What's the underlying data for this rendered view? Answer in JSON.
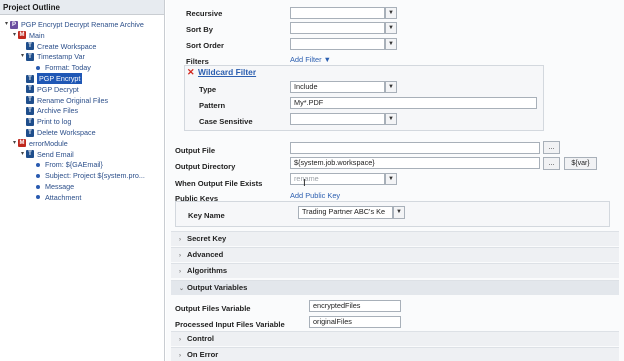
{
  "outline": {
    "title": "Project Outline",
    "nodes": [
      {
        "label": "PGP Encrypt Decrypt Rename Archive",
        "icon": "P",
        "twisty": "▾"
      },
      {
        "label": "Main",
        "icon": "M",
        "twisty": "▾"
      },
      {
        "label": "Create Workspace",
        "icon": "T",
        "twisty": ""
      },
      {
        "label": "Timestamp Var",
        "icon": "T",
        "twisty": "▾"
      },
      {
        "label": "Format: Today",
        "icon": "dot",
        "twisty": ""
      },
      {
        "label": "PGP Encrypt",
        "icon": "T",
        "twisty": ""
      },
      {
        "label": "PGP Decrypt",
        "icon": "T",
        "twisty": ""
      },
      {
        "label": "Rename Original Files",
        "icon": "T",
        "twisty": ""
      },
      {
        "label": "Archive Files",
        "icon": "T",
        "twisty": ""
      },
      {
        "label": "Print to log",
        "icon": "T",
        "twisty": ""
      },
      {
        "label": "Delete Workspace",
        "icon": "T",
        "twisty": ""
      },
      {
        "label": "errorModule",
        "icon": "M",
        "twisty": "▾"
      },
      {
        "label": "Send Email",
        "icon": "T",
        "twisty": "▾"
      },
      {
        "label": "From: ${GAEmail}",
        "icon": "dot",
        "twisty": ""
      },
      {
        "label": "Subject: Project ${system.pro...",
        "icon": "dot",
        "twisty": ""
      },
      {
        "label": "Message",
        "icon": "dot",
        "twisty": ""
      },
      {
        "label": "Attachment",
        "icon": "dot",
        "twisty": ""
      }
    ]
  },
  "form": {
    "recursive_label": "Recursive",
    "recursive_value": "",
    "sort_by_label": "Sort By",
    "sort_by_value": "",
    "sort_order_label": "Sort Order",
    "sort_order_value": "",
    "filters_label": "Filters",
    "add_filter": "Add Filter ▼",
    "wildcard_title": "Wildcard Filter",
    "type_label": "Type",
    "type_value": "Include",
    "pattern_label": "Pattern",
    "pattern_value": "My*.PDF",
    "case_label": "Case Sensitive",
    "case_value": "",
    "output_file_label": "Output File",
    "output_file_value": "",
    "output_dir_label": "Output Directory",
    "output_dir_value": "${system.job.workspace}",
    "browse": "...",
    "var_button": "${var}",
    "when_exists_label": "When Output File Exists",
    "when_exists_placeholder": "rename",
    "public_keys_label": "Public Keys",
    "add_public_key": "Add Public Key",
    "key_name_label": "Key Name",
    "key_name_value": "Trading Partner ABC's Ke"
  },
  "sections": {
    "secret_key": "Secret Key",
    "advanced": "Advanced",
    "algorithms": "Algorithms",
    "output_variables": "Output Variables",
    "output_files_var_label": "Output Files Variable",
    "output_files_var_value": "encryptedFiles",
    "processed_input_label": "Processed Input Files Variable",
    "processed_input_value": "originalFiles",
    "control": "Control",
    "on_error": "On Error"
  },
  "icons": {
    "chevron_collapsed": "›",
    "chevron_expanded": "⌄",
    "dropdown": "▼",
    "remove": "✕"
  }
}
